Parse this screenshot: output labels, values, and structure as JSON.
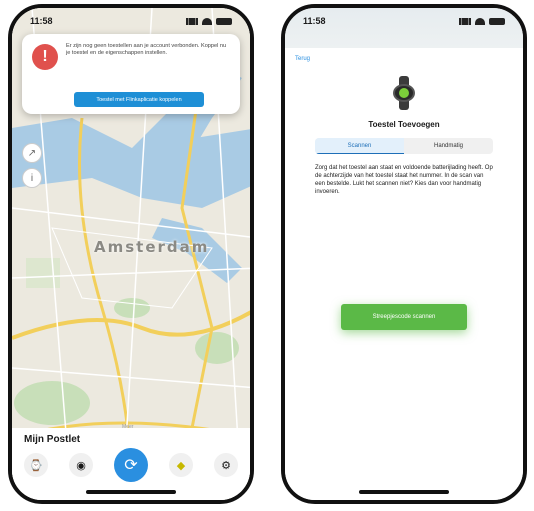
{
  "status_bar": {
    "time_left": "11:58",
    "time_right": "11:58"
  },
  "notification": {
    "icon": "!",
    "message": "Er zijn nog geen toestellen aan je account verbonden. Koppel nu je toestel en de eigenschappen instellen.",
    "button_label": "Toestel met Flinkaplicatie koppelen"
  },
  "map": {
    "city_label": "Amsterdam",
    "controls": [
      "arrow",
      "info"
    ]
  },
  "bottom_sheet": {
    "label": "Meer",
    "title": "Mijn Postlet",
    "tabs": [
      {
        "name": "watch-tab",
        "icon": "watch"
      },
      {
        "name": "tracker-tab",
        "icon": "tracker"
      },
      {
        "name": "sync-tab",
        "icon": "sync"
      },
      {
        "name": "bell-tab",
        "icon": "bell"
      },
      {
        "name": "settings-tab",
        "icon": "gear"
      }
    ]
  },
  "pairing": {
    "back_label": "Terug",
    "title": "Toestel Toevoegen",
    "segments": [
      "Scannen",
      "Handmatig"
    ],
    "description": "Zorg dat het toestel aan staat en voldoende batterijlading heeft. Op de achterzijde van het toestel staat het nummer. In de scan van een bestelde. Lukt het scannen niet? Kies dan voor handmatig invoeren.",
    "scan_button": "Streepjescode scannen"
  },
  "colors": {
    "accent_blue": "#2a8fe0",
    "alert_red": "#e0514d",
    "success_green": "#5bb947"
  }
}
